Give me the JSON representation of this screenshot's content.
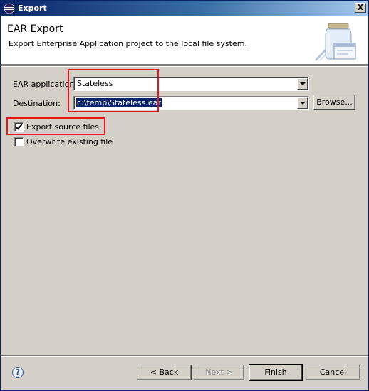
{
  "window": {
    "title": "Export",
    "close_glyph": "X"
  },
  "header": {
    "title": "EAR Export",
    "description": "Export Enterprise Application project to the local file system."
  },
  "form": {
    "ear_application": {
      "label": "EAR application:",
      "value": "Stateless"
    },
    "destination": {
      "label": "Destination:",
      "value": "c:\\temp\\Stateless.ear",
      "browse_label": "Browse..."
    },
    "export_source_files": {
      "label": "Export source files",
      "checked": true
    },
    "overwrite_existing_file": {
      "label": "Overwrite existing file",
      "checked": false
    }
  },
  "footer": {
    "help_glyph": "?",
    "back_label": "< Back",
    "next_label": "Next >",
    "finish_label": "Finish",
    "cancel_label": "Cancel"
  },
  "colors": {
    "highlight_box": "#e8141c",
    "titlebar": "#0a246a",
    "dialog_bg": "#d4d0c8"
  },
  "icons": {
    "title": "eclipse-icon",
    "banner": "jar-export-wizard-icon",
    "help": "help-icon"
  }
}
